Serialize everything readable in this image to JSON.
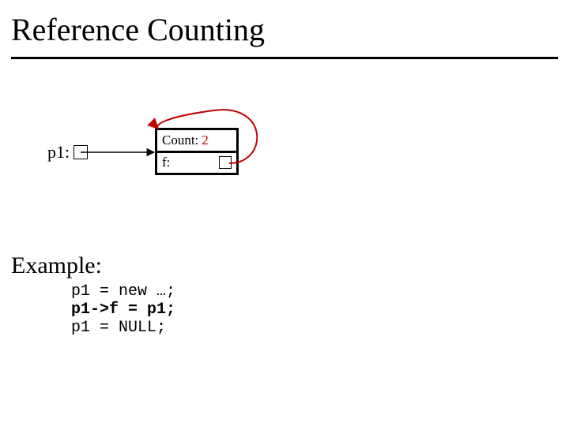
{
  "title": "Reference Counting",
  "p1_label": "p1:",
  "object": {
    "count_label": "Count:",
    "count_value": "2",
    "f_label": "f:"
  },
  "example_label": "Example:",
  "code": {
    "line1": "p1 = new …;",
    "line2": "p1->f = p1;",
    "line3": "p1 = NULL;"
  },
  "colors": {
    "accent_red": "#c00000"
  }
}
